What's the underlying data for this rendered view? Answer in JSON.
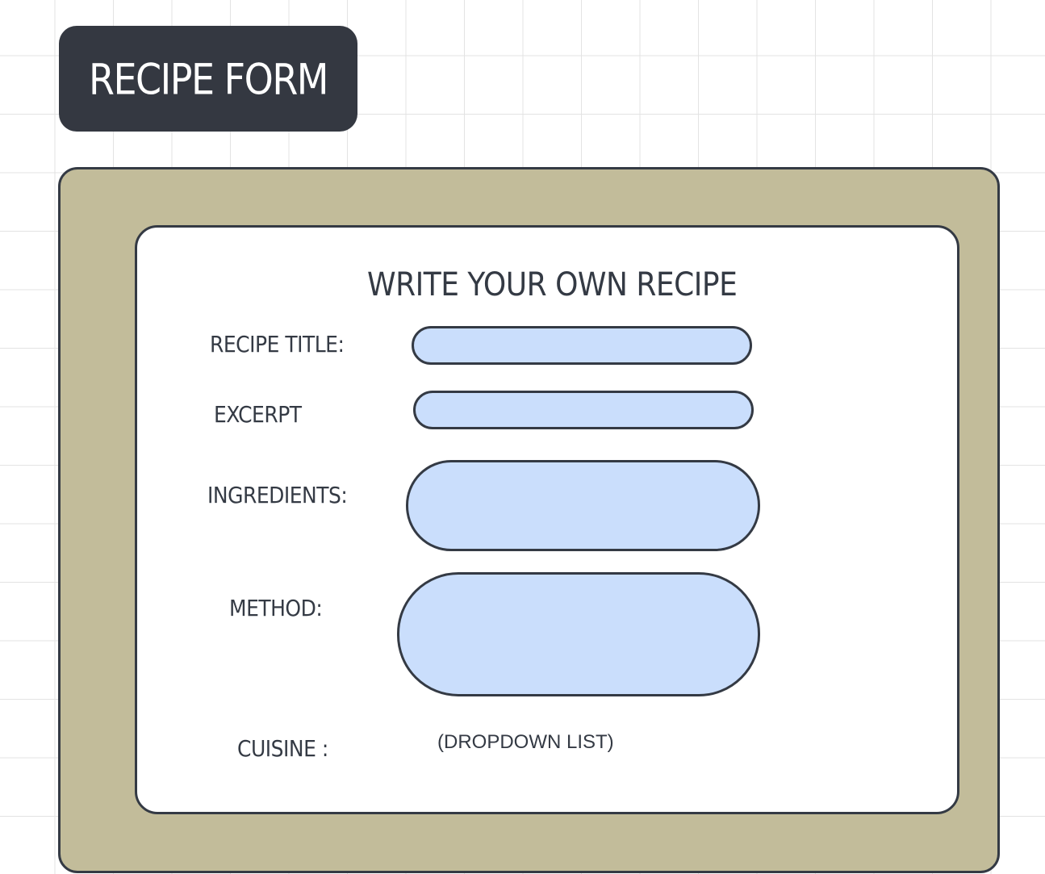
{
  "header": {
    "title": "RECIPE FORM"
  },
  "form": {
    "heading": "WRITE YOUR OWN RECIPE",
    "fields": {
      "recipe_title": {
        "label": "RECIPE TITLE:",
        "value": ""
      },
      "excerpt": {
        "label": "EXCERPT",
        "value": ""
      },
      "ingredients": {
        "label": "INGREDIENTS:",
        "value": ""
      },
      "method": {
        "label": "METHOD:",
        "value": ""
      },
      "cuisine": {
        "label": "CUISINE :",
        "placeholder": "(DROPDOWN LIST)"
      }
    }
  },
  "colors": {
    "badge_background": "#343841",
    "frame_background": "#c2bc9a",
    "input_fill": "#cadefc",
    "outline": "#343a44"
  }
}
